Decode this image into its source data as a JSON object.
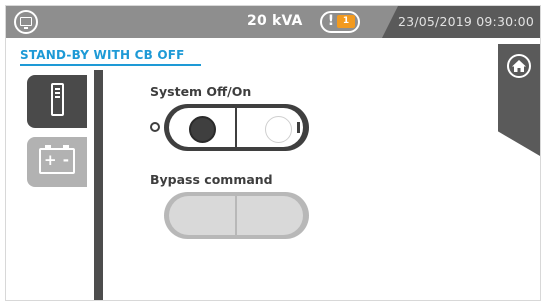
{
  "header": {
    "power_rating": "20 kVA",
    "alarm_count": "1",
    "alarm_symbol": "!",
    "datetime": "23/05/2019 09:30:00",
    "icons": [
      "monitor-icon",
      "alarm-icon"
    ]
  },
  "page": {
    "title": "STAND-BY WITH CB OFF"
  },
  "tabs": [
    {
      "name": "device",
      "icon": "ups-cabinet-icon",
      "active": true
    },
    {
      "name": "battery",
      "icon": "battery-icon",
      "active": false,
      "plus": "+",
      "minus": "-"
    }
  ],
  "controls": {
    "system_switch": {
      "label": "System Off/On",
      "state": "off",
      "enabled": true
    },
    "bypass_switch": {
      "label": "Bypass command",
      "state": "none",
      "enabled": false
    }
  },
  "colors": {
    "accent": "#1e9ad6",
    "header_bg": "#8e8e8e",
    "dark": "#3f3f3f",
    "alarm_badge": "#f29a1f"
  }
}
